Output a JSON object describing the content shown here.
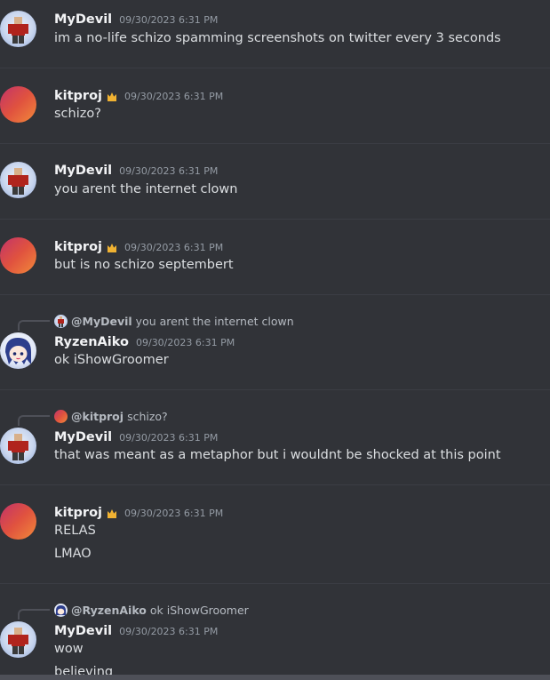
{
  "messages": [
    {
      "author": "MyDevil",
      "timestamp": "09/30/2023 6:31 PM",
      "lines": [
        "im a no-life schizo spamming screenshots on twitter every 3 seconds"
      ]
    },
    {
      "author": "kitproj",
      "timestamp": "09/30/2023 6:31 PM",
      "lines": [
        "schizo?"
      ]
    },
    {
      "author": "MyDevil",
      "timestamp": "09/30/2023 6:31 PM",
      "lines": [
        "you arent the internet clown"
      ]
    },
    {
      "author": "kitproj",
      "timestamp": "09/30/2023 6:31 PM",
      "lines": [
        "but is no schizo septembert"
      ]
    },
    {
      "author": "RyzenAiko",
      "timestamp": "09/30/2023 6:31 PM",
      "reply": {
        "name": "@MyDevil",
        "text": "you arent the internet clown"
      },
      "lines": [
        "ok iShowGroomer"
      ]
    },
    {
      "author": "MyDevil",
      "timestamp": "09/30/2023 6:31 PM",
      "reply": {
        "name": "@kitproj",
        "text": "schizo?"
      },
      "lines": [
        "that was meant as a metaphor but i wouldnt be shocked at this point"
      ]
    },
    {
      "author": "kitproj",
      "timestamp": "09/30/2023 6:31 PM",
      "lines": [
        "RELAS",
        "LMAO"
      ]
    },
    {
      "author": "MyDevil",
      "timestamp": "09/30/2023 6:31 PM",
      "reply": {
        "name": "@RyzenAiko",
        "text": "ok iShowGroomer"
      },
      "lines": [
        "wow",
        "believing"
      ]
    }
  ],
  "icons": {
    "owner_badge": "crown-icon",
    "owner_badge_color": "#f0b232"
  },
  "colors": {
    "background": "#313338",
    "username": "#f2f3f5",
    "message_text": "#dbdee1",
    "timestamp": "#949ba4"
  }
}
